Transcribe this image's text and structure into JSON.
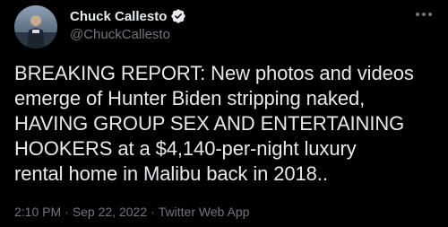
{
  "author": {
    "display_name": "Chuck Callesto",
    "handle": "@ChuckCallesto",
    "verified": true,
    "avatar": "avatar-photo"
  },
  "tweet": {
    "text": "BREAKING REPORT: New photos and videos\nemerge of Hunter Biden stripping naked,\nHAVING GROUP SEX AND ENTERTAINING\nHOOKERS at a $4,140-per-night luxury\nrental home in Malibu back in 2018.."
  },
  "meta": {
    "time": "2:10 PM",
    "separator": "·",
    "date": "Sep 22, 2022",
    "source": "Twitter Web App"
  },
  "icons": {
    "verified": "verified-badge-icon",
    "more": "more-options-icon"
  },
  "colors": {
    "background": "#000000",
    "text": "#e7e9ea",
    "secondary": "#71767b",
    "verified_badge": "#e7e9ea"
  }
}
